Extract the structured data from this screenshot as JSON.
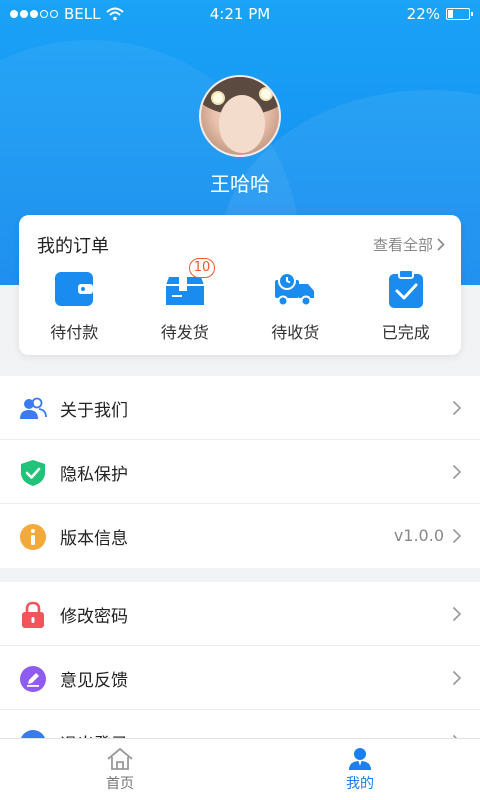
{
  "status_bar": {
    "carrier": "BELL",
    "time": "4:21 PM",
    "battery": "22%"
  },
  "profile": {
    "username": "王哈哈"
  },
  "orders": {
    "title": "我的订单",
    "view_all": "查看全部",
    "items": [
      {
        "label": "待付款",
        "icon": "wallet-icon"
      },
      {
        "label": "待发货",
        "icon": "package-icon",
        "badge": "10"
      },
      {
        "label": "待收货",
        "icon": "delivery-truck-icon"
      },
      {
        "label": "已完成",
        "icon": "clipboard-check-icon"
      }
    ]
  },
  "menu_group_1": [
    {
      "label": "关于我们",
      "icon": "users-icon"
    },
    {
      "label": "隐私保护",
      "icon": "shield-check-icon"
    },
    {
      "label": "版本信息",
      "icon": "info-icon",
      "value": "v1.0.0"
    }
  ],
  "menu_group_2": [
    {
      "label": "修改密码",
      "icon": "lock-icon"
    },
    {
      "label": "意见反馈",
      "icon": "edit-feedback-icon"
    },
    {
      "label": "退出登录",
      "icon": "logout-icon"
    }
  ],
  "tabbar": {
    "tabs": [
      {
        "label": "首页",
        "icon": "home-icon",
        "active": false
      },
      {
        "label": "我的",
        "icon": "user-icon",
        "active": true
      }
    ]
  },
  "colors": {
    "header_blue": "#1aa3f7",
    "accent_blue": "#1a7ff0",
    "badge_orange": "#f05a2e"
  }
}
